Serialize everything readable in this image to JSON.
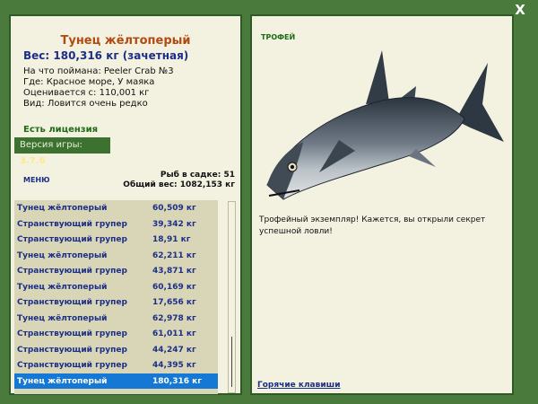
{
  "close_label": "X",
  "fish": {
    "title": "Тунец жёлтоперый",
    "weight": "Вес: 180,316 кг (зачетная)",
    "caught_on": "На что поймана: Peeler Crab №3",
    "where": "Где: Красное море, У маяка",
    "value": "Оценивается с: 110,001 кг",
    "kind": "Вид: Ловится очень редко"
  },
  "license": "Есть лицензия",
  "version": {
    "label": "Версия игры:",
    "value": "3.7.6"
  },
  "menu_label": "МЕНЮ",
  "stats": {
    "count": "Рыб в садке: 51",
    "total": "Общий вес: 1082,153 кг"
  },
  "catch_list": [
    {
      "name": "Тунец жёлтоперый",
      "weight": "60,509 кг"
    },
    {
      "name": "Странствующий групер",
      "weight": "39,342 кг"
    },
    {
      "name": "Странствующий групер",
      "weight": "18,91 кг"
    },
    {
      "name": "Тунец жёлтоперый",
      "weight": "62,211 кг"
    },
    {
      "name": "Странствующий групер",
      "weight": "43,871 кг"
    },
    {
      "name": "Тунец жёлтоперый",
      "weight": "60,169 кг"
    },
    {
      "name": "Странствующий групер",
      "weight": "17,656 кг"
    },
    {
      "name": "Тунец жёлтоперый",
      "weight": "62,978 кг"
    },
    {
      "name": "Странствующий групер",
      "weight": "61,011 кг"
    },
    {
      "name": "Странствующий групер",
      "weight": "44,247 кг"
    },
    {
      "name": "Странствующий групер",
      "weight": "44,395 кг"
    },
    {
      "name": "Тунец жёлтоперый",
      "weight": "180,316 кг"
    }
  ],
  "selected_index": 11,
  "trophy": {
    "label": "ТРОФЕЙ",
    "text": "Трофейный экземпляр! Кажется, вы открыли секрет успешной ловли!"
  },
  "hotkeys_label": "Горячие клавиши",
  "colors": {
    "background": "#4a7a3c",
    "panel": "#f3f2e1",
    "selection": "#1478d4",
    "title": "#b24a14",
    "accent": "#1c2e88"
  }
}
